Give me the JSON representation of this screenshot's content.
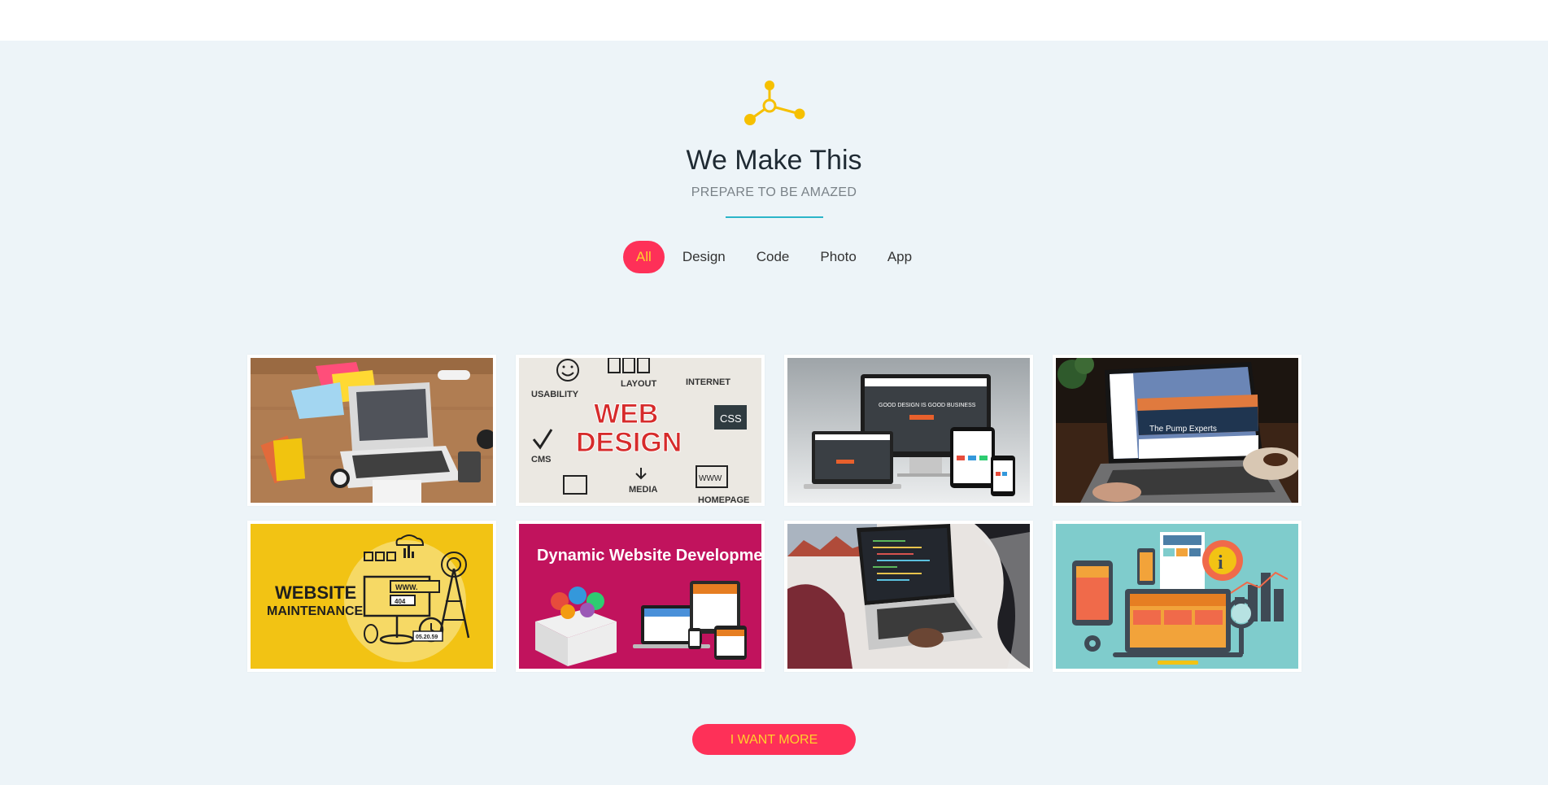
{
  "header": {
    "icon": "share-nodes-icon",
    "title": "We Make This",
    "subtitle": "PREPARE TO BE AMAZED"
  },
  "colors": {
    "accent": "#fe3058",
    "accent_text": "#ffd12b",
    "divider": "#2bb5c8",
    "icon": "#f6c000",
    "background": "#edf4f8"
  },
  "filters": [
    {
      "label": "All",
      "active": true
    },
    {
      "label": "Design",
      "active": false
    },
    {
      "label": "Code",
      "active": false
    },
    {
      "label": "Photo",
      "active": false
    },
    {
      "label": "App",
      "active": false
    }
  ],
  "portfolio": [
    {
      "name": "laptop-desk-photo"
    },
    {
      "name": "web-design-graphic",
      "text": [
        "USABILITY",
        "LAYOUT",
        "INTERNET",
        "WEB",
        "DESIGN",
        "CSS",
        "CMS",
        "MEDIA",
        "WWW",
        "HOMEPAGE"
      ]
    },
    {
      "name": "responsive-devices-mockup",
      "text": [
        "GOOD DESIGN IS GOOD BUSINESS"
      ]
    },
    {
      "name": "laptop-website-photo",
      "text": [
        "The Pump Experts"
      ]
    },
    {
      "name": "website-maintenance-graphic",
      "text": [
        "WEBSITE",
        "MAINTENANCE",
        "WWW.",
        "404",
        "05.20.59"
      ]
    },
    {
      "name": "dynamic-website-development-graphic",
      "text": [
        "Dynamic Website Development"
      ]
    },
    {
      "name": "coding-laptop-photo"
    },
    {
      "name": "flat-devices-illustration"
    }
  ],
  "cta": {
    "label": "I WANT MORE"
  }
}
